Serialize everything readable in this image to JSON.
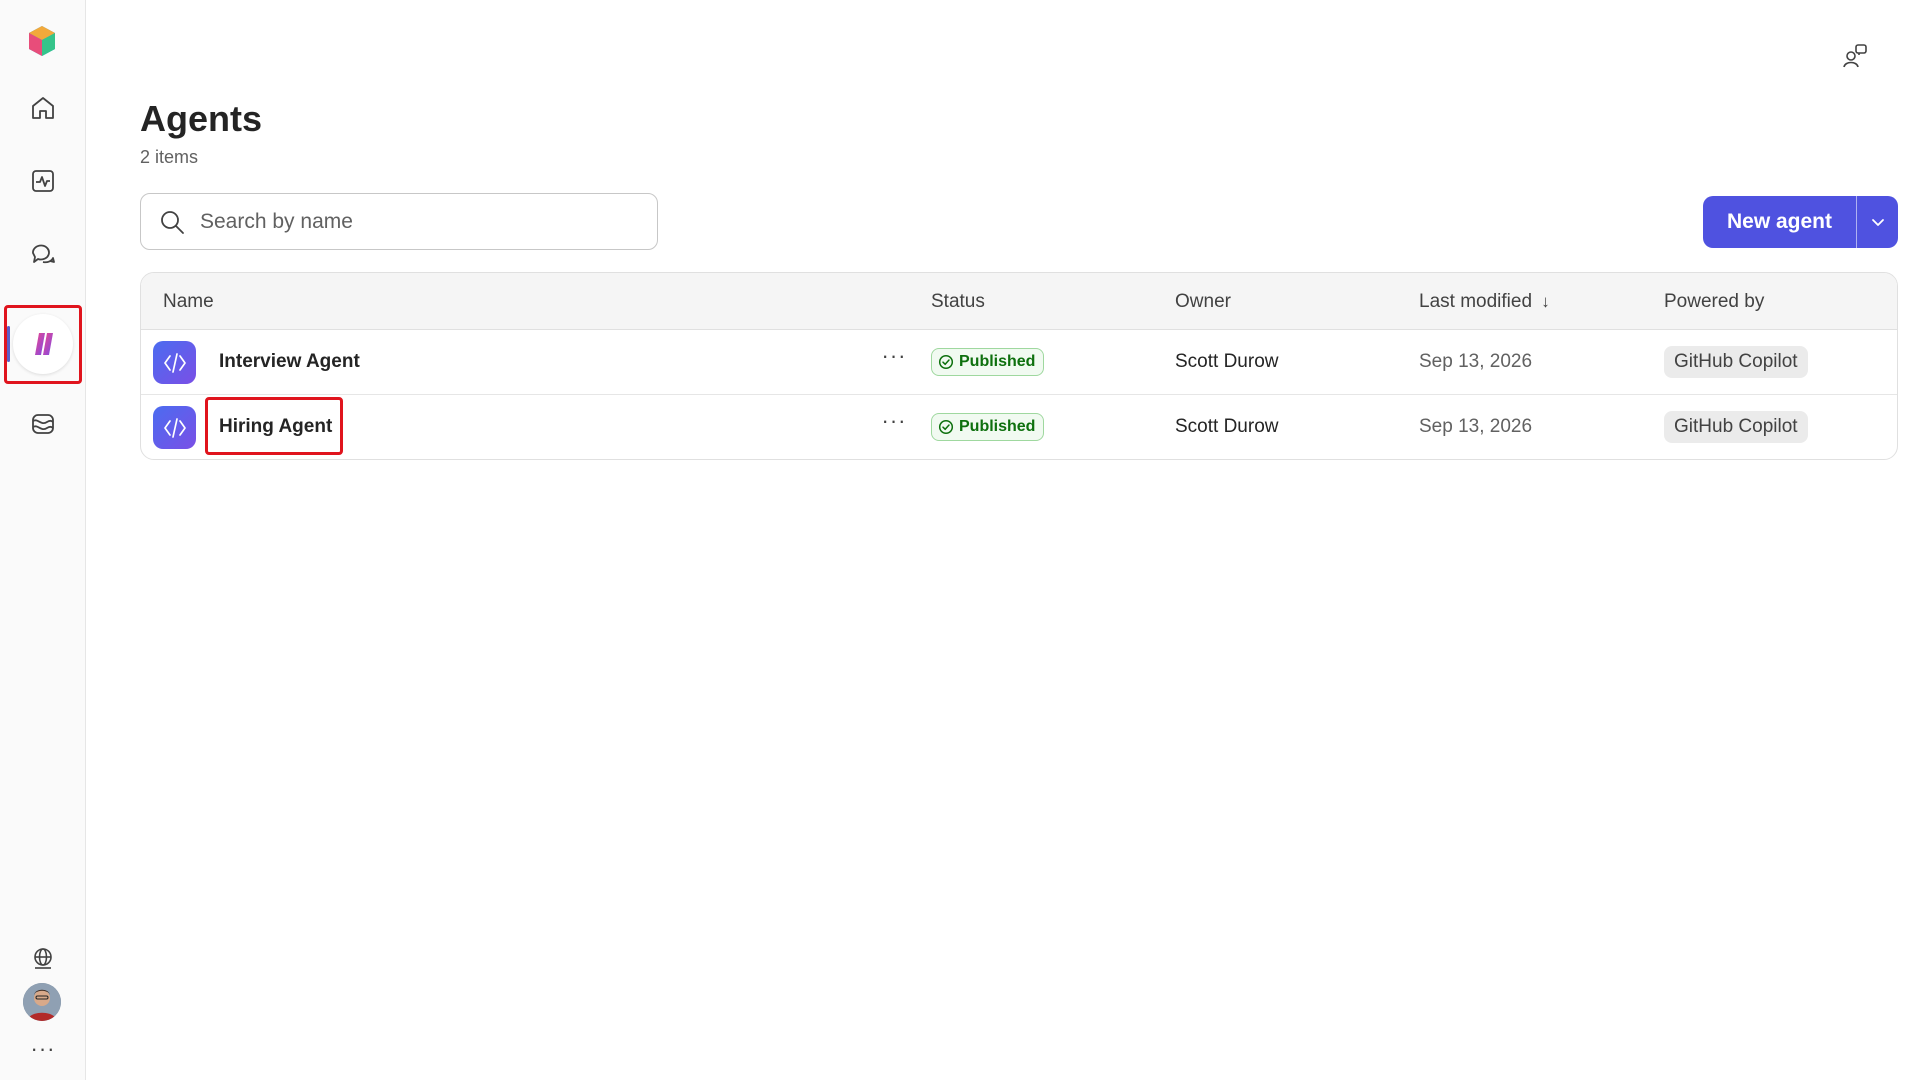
{
  "header": {
    "title": "Agents",
    "count": "2 items"
  },
  "search": {
    "placeholder": "Search by name",
    "value": ""
  },
  "toolbar": {
    "new_agent_label": "New agent"
  },
  "table": {
    "columns": [
      "Name",
      "Status",
      "Owner",
      "Last modified",
      "Powered by"
    ],
    "sort_indicator": "↓",
    "rows": [
      {
        "name": "Interview Agent",
        "status": "Published",
        "owner": "Scott Durow",
        "modified": "Sep 13, 2026",
        "powered_by": "GitHub Copilot",
        "more": "···"
      },
      {
        "name": "Hiring Agent",
        "status": "Published",
        "owner": "Scott Durow",
        "modified": "Sep 13, 2026",
        "powered_by": "GitHub Copilot",
        "more": "···"
      }
    ]
  },
  "rail": {
    "items": [
      "home-icon",
      "activity-icon",
      "chat-icon",
      "agents-icon",
      "flows-icon"
    ],
    "bottom": [
      "globe-icon",
      "avatar",
      "more-icon"
    ],
    "more": "···"
  },
  "colors": {
    "accent": "#4f52e0",
    "highlight": "#e0141d",
    "published": "#0e700e"
  }
}
